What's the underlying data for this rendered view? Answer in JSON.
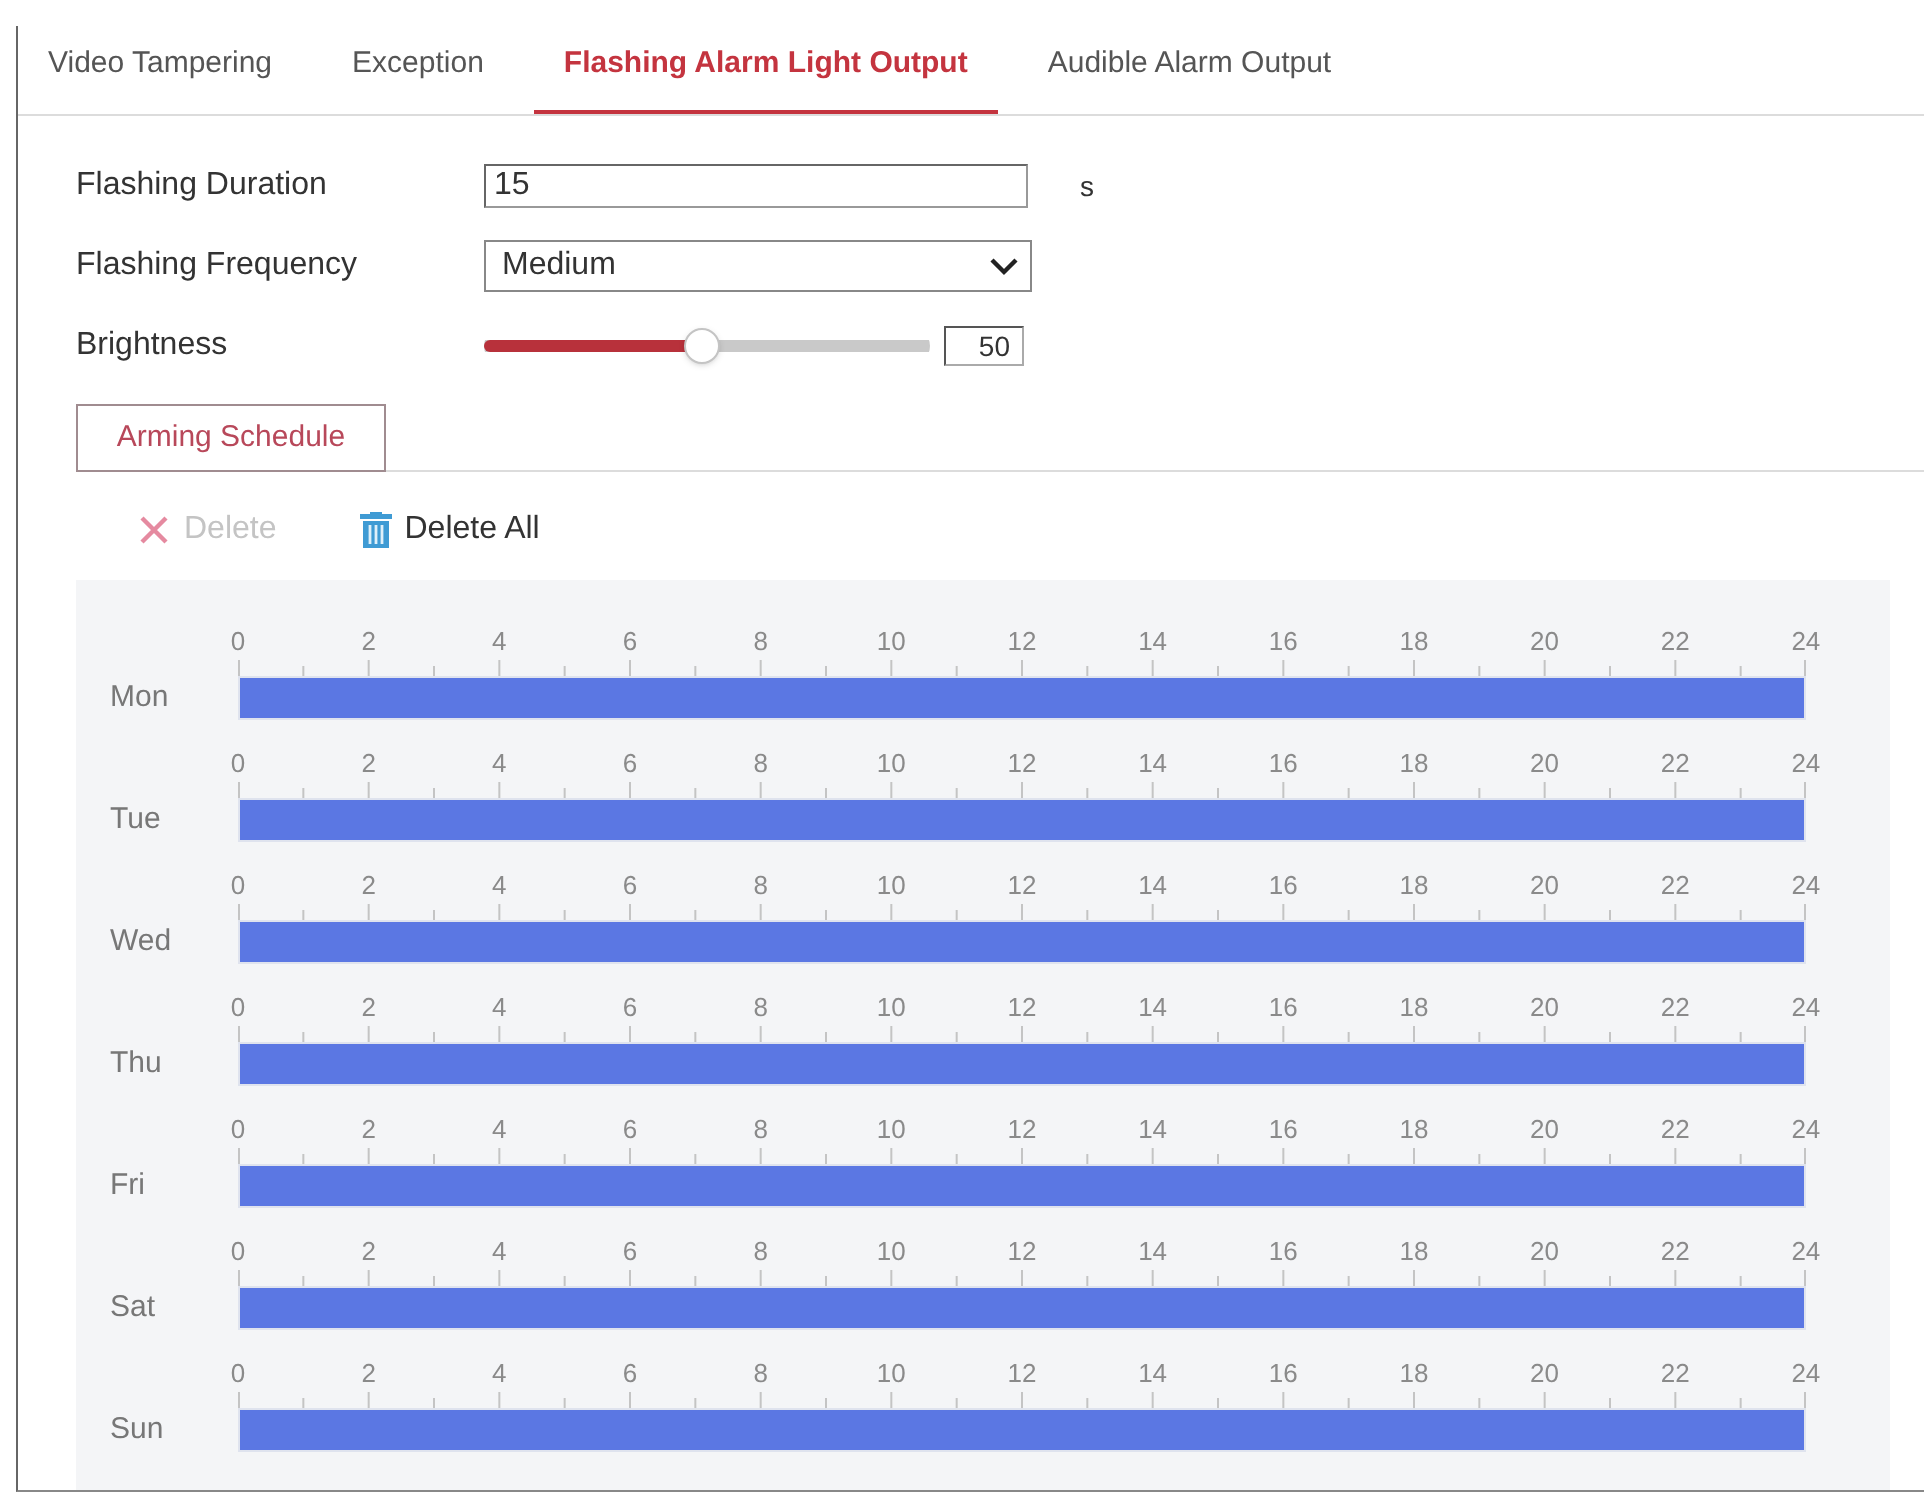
{
  "tabs": [
    {
      "label": "Video Tampering",
      "selected": false
    },
    {
      "label": "Exception",
      "selected": false
    },
    {
      "label": "Flashing Alarm Light Output",
      "selected": true
    },
    {
      "label": "Audible Alarm Output",
      "selected": false
    }
  ],
  "form": {
    "duration": {
      "label": "Flashing Duration",
      "value": "15",
      "unit": "s"
    },
    "frequency": {
      "label": "Flashing Frequency",
      "value": "Medium"
    },
    "brightness": {
      "label": "Brightness",
      "level": 0.49,
      "value": "50"
    }
  },
  "schedule_tabs": [
    {
      "label": "Arming Schedule",
      "selected": true
    }
  ],
  "toolbar": [
    {
      "label": "Delete",
      "kind": "delete",
      "disabled": true
    },
    {
      "label": "Delete All",
      "kind": "delete_all",
      "disabled": false
    }
  ],
  "schedule": [
    {
      "day": "Mon",
      "ticks": [
        "0",
        "2",
        "4",
        "6",
        "8",
        "10",
        "12",
        "14",
        "16",
        "18",
        "20",
        "22",
        "24"
      ],
      "level": 1
    },
    {
      "day": "Tue",
      "ticks": [
        "0",
        "2",
        "4",
        "6",
        "8",
        "10",
        "12",
        "14",
        "16",
        "18",
        "20",
        "22",
        "24"
      ],
      "level": 1
    },
    {
      "day": "Wed",
      "ticks": [
        "0",
        "2",
        "4",
        "6",
        "8",
        "10",
        "12",
        "14",
        "16",
        "18",
        "20",
        "22",
        "24"
      ],
      "level": 1
    },
    {
      "day": "Thu",
      "ticks": [
        "0",
        "2",
        "4",
        "6",
        "8",
        "10",
        "12",
        "14",
        "16",
        "18",
        "20",
        "22",
        "24"
      ],
      "level": 1
    },
    {
      "day": "Fri",
      "ticks": [
        "0",
        "2",
        "4",
        "6",
        "8",
        "10",
        "12",
        "14",
        "16",
        "18",
        "20",
        "22",
        "24"
      ],
      "level": 1
    },
    {
      "day": "Sat",
      "ticks": [
        "0",
        "2",
        "4",
        "6",
        "8",
        "10",
        "12",
        "14",
        "16",
        "18",
        "20",
        "22",
        "24"
      ],
      "level": 1
    },
    {
      "day": "Sun",
      "ticks": [
        "0",
        "2",
        "4",
        "6",
        "8",
        "10",
        "12",
        "14",
        "16",
        "18",
        "20",
        "22",
        "24"
      ],
      "level": 1
    }
  ]
}
